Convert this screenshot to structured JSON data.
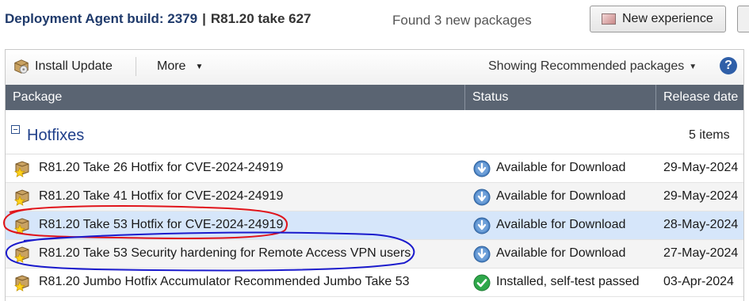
{
  "header": {
    "build_label": "Deployment Agent build: 2379",
    "separator": "|",
    "version_label": "R81.20 take 627",
    "found_text": "Found 3 new packages",
    "new_experience_label": "New experience"
  },
  "toolbar": {
    "install_update_label": "Install Update",
    "more_label": "More",
    "showing_label": "Showing Recommended packages",
    "help_symbol": "?"
  },
  "columns": {
    "package": "Package",
    "status": "Status",
    "release_date": "Release date"
  },
  "group": {
    "title": "Hotfixes",
    "count": "5 items"
  },
  "rows": [
    {
      "name": "R81.20 Take 26 Hotfix for CVE-2024-24919",
      "status": "Available for Download",
      "status_icon": "download-icon",
      "date": "29-May-2024"
    },
    {
      "name": "R81.20 Take 41 Hotfix for CVE-2024-24919",
      "status": "Available for Download",
      "status_icon": "download-icon",
      "date": "29-May-2024"
    },
    {
      "name": "R81.20 Take 53 Hotfix for CVE-2024-24919",
      "status": "Available for Download",
      "status_icon": "download-icon",
      "date": "28-May-2024"
    },
    {
      "name": "R81.20 Take 53 Security hardening for Remote Access VPN users",
      "status": "Available for Download",
      "status_icon": "download-icon",
      "date": "27-May-2024"
    },
    {
      "name": "R81.20 Jumbo Hotfix Accumulator Recommended Jumbo Take 53",
      "status": "Installed, self-test passed",
      "status_icon": "check-icon",
      "date": "03-Apr-2024"
    }
  ],
  "colors": {
    "header_bg": "#5a6472",
    "selected_row": "#d6e6fa",
    "group_title": "#1f3f8a",
    "annotation_red": "#e0141b",
    "annotation_blue": "#1a1acc"
  }
}
